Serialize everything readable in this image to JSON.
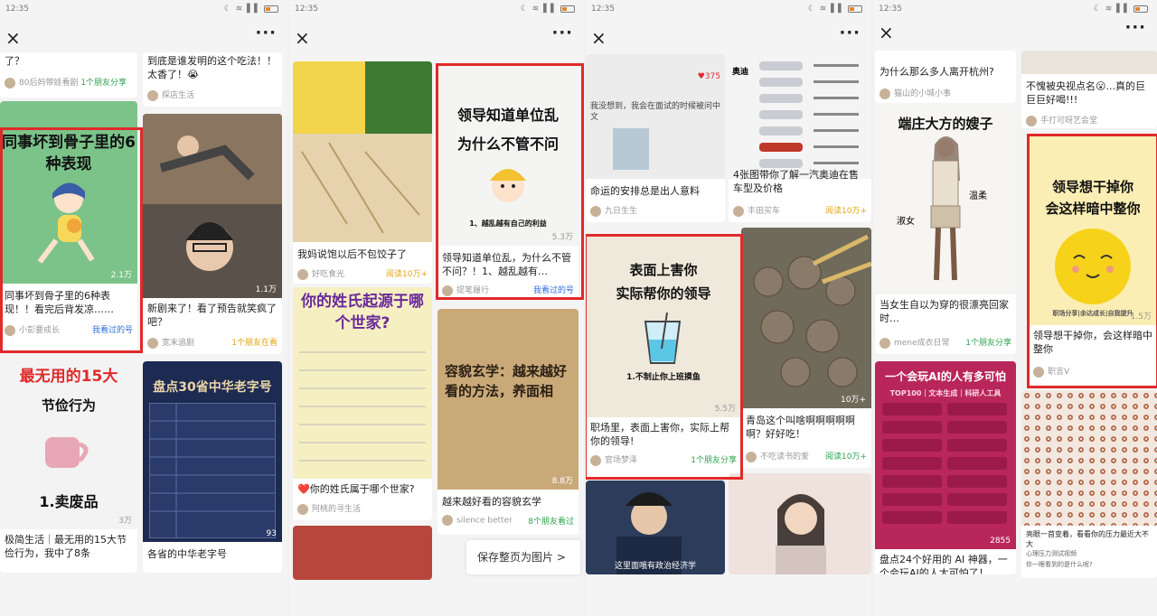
{
  "status_bar": {
    "time": "12:35",
    "icons": "☾ ≋ ▌▌"
  },
  "nav": {
    "close": "×",
    "more": "···"
  },
  "p1": {
    "top_left_caption": "了？",
    "top_left_user": "80后妈带娃看剧",
    "top_left_stat": "1个朋友分享",
    "top_right_caption": "到底是谁发明的这个吃法！！太香了！😭",
    "top_right_user": "探店生活",
    "c1_title": "同事坏到骨子里的6种表现",
    "c1_views": "2.1万",
    "c1_caption": "同事坏到骨子里的6种表现！！看完后背发凉……",
    "c1_user": "小彭要成长",
    "c1_stat": "我看过的号",
    "c2_views": "1.1万",
    "c2_caption": "新剧来了！看了预告就笑疯了吧？",
    "c2_user": "宽末追剧",
    "c2_stat": "1个朋友在看",
    "c3_title1": "最无用的15大",
    "c3_title2": "节俭行为",
    "c3_sub": "1.卖废品",
    "c3_views": "3万",
    "c3_caption": "极简生活｜最无用的15大节俭行为，我中了8条",
    "c3_user": "",
    "c4_title": "盘点30省中华老字号",
    "c4_views": "93",
    "c4_caption": "各省的中华老字号"
  },
  "p2": {
    "c1_caption": "我妈说饱以后不包饺子了",
    "c1_user": "好吃食光",
    "c1_stat": "阅读10万+",
    "c2_title": "你的姓氏起源于哪个世家?",
    "c2_caption": "❤️你的姓氏属于哪个世家?",
    "c2_user": "阿桃的寻生活",
    "c3_title1": "领导知道单位乱",
    "c3_title2": "为什么不管不问",
    "c3_sub": "1、越乱越有自己的利益",
    "c3_views": "5.3万",
    "c3_caption": "领导知道单位乱，为什么不管不问？！1、越乱越有…",
    "c3_user": "提笔履行",
    "c3_stat": "我看过的号",
    "c4_title": "容貌玄学：越来越好看的方法，养面相",
    "c4_views": "8.8万",
    "c4_caption": "越来越好看的容貌玄学",
    "c4_user": "silence better",
    "c4_stat": "8个朋友看过",
    "save": "保存整页为图片  >"
  },
  "p3": {
    "c1_caption": "命运的安排总是出人意料",
    "c1_user": "九日生生",
    "c1_comment": "我没想到，我会在面试的时候被问中文",
    "c1_likes": "♥375",
    "c2_caption": "4张图带你了解一汽奥迪在售车型及价格",
    "c2_user": "丰田买车",
    "c2_stat": "阅读10万+",
    "c2_brand": "奥迪",
    "c3_title1": "表面上害你",
    "c3_title2": "实际帮你的领导",
    "c3_sub": "1.不制止你上班摸鱼",
    "c3_views": "5.5万",
    "c3_caption": "职场里，表面上害你，实际上帮你的领导!",
    "c3_user": "官场梦泽",
    "c3_stat": "1个朋友分享",
    "c4_views": "10万+",
    "c4_caption": "青岛这个叫啥啊啊啊啊啊啊？好好吃！",
    "c4_user": "不吃读书的爱",
    "c4_stat": "阅读10万+",
    "c5_note": "这里面哦有政治经济学"
  },
  "p4": {
    "c1_caption": "为什么那么多人离开杭州?",
    "c1_user": "猫山的小城小事",
    "c2_caption": "不愧被央视点名😮...真的巨巨巨好喝!!!",
    "c2_user": "手打可呀艺会堂",
    "c3_title": "端庄大方的嫂子",
    "c3_l1": "淑女",
    "c3_l2": "温柔",
    "c3_caption": "当女生自以为穿的很漂亮回家时…",
    "c3_user": "mene成衣日常",
    "c3_stat": "1个朋友分享",
    "c4_title1": "领导想干掉你",
    "c4_title2": "会这样暗中整你",
    "c4_sub": "职场分享|余达成长|自我提升",
    "c4_views": "1.5万",
    "c4_caption": "领导想干掉你，会这样暗中整你",
    "c4_user": "职言V",
    "c5_title": "一个会玩AI的人有多可怕",
    "c5_sub": "TOP100｜文本生成｜科研人工具",
    "c5_views": "2855",
    "c5_caption": "盘点24个好用的 AI 神器，一个会玩AI的人太可怕了！",
    "c6_caption": "亮眼一首变着，看看你的压力最近大不大",
    "c6_sub": "心理压力测试视频",
    "c6_sub2": "你一眼看到的是什么呢?"
  },
  "colors": {
    "highlight": "#e12a2a",
    "green": "#2fa34f",
    "orange": "#e3a417",
    "blue": "#2f6ed8"
  }
}
